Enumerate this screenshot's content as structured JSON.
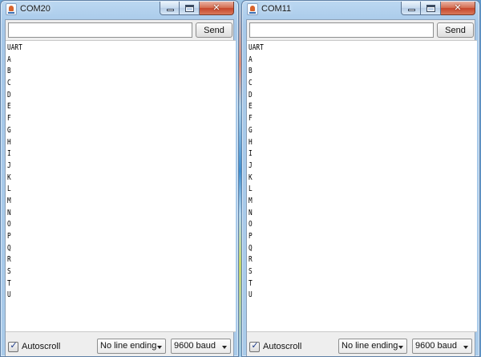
{
  "windows": [
    {
      "title": "COM20",
      "input_value": "",
      "send_label": "Send",
      "lines": [
        "UART",
        "A",
        "B",
        "C",
        "D",
        "E",
        "F",
        "G",
        "H",
        "I",
        "J",
        "K",
        "L",
        "M",
        "N",
        "O",
        "P",
        "Q",
        "R",
        "S",
        "T",
        "U"
      ],
      "autoscroll_label": "Autoscroll",
      "autoscroll_checked": true,
      "line_ending": "No line ending",
      "baud": "9600 baud"
    },
    {
      "title": "COM11",
      "input_value": "",
      "send_label": "Send",
      "lines": [
        "UART",
        "A",
        "B",
        "C",
        "D",
        "E",
        "F",
        "G",
        "H",
        "I",
        "J",
        "K",
        "L",
        "M",
        "N",
        "O",
        "P",
        "Q",
        "R",
        "S",
        "T",
        "U"
      ],
      "autoscroll_label": "Autoscroll",
      "autoscroll_checked": true,
      "line_ending": "No line ending",
      "baud": "9600 baud"
    }
  ],
  "icons": {
    "app": "java-app-icon",
    "minimize": "minimize-icon",
    "maximize": "maximize-icon",
    "close": "close-icon",
    "checkmark": "checkmark-icon",
    "dropdown": "chevron-down-icon"
  },
  "colors": {
    "titlebar": "#a9cbea",
    "close_button": "#c6452a",
    "client_background": "#eeeeee",
    "monitor_background": "#ffffff"
  }
}
